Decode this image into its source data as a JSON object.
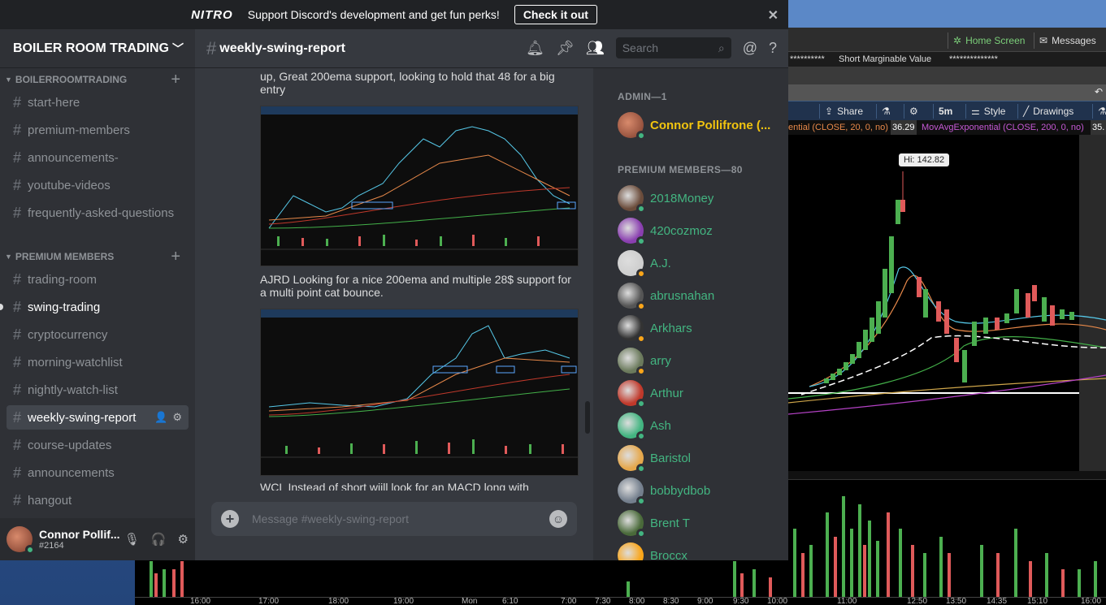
{
  "nitro": {
    "logo": "NITRO",
    "text": "Support Discord's development and get fun perks!",
    "button": "Check it out",
    "close": "✕"
  },
  "server": {
    "name": "BOILER ROOM TRADING"
  },
  "categories": [
    {
      "label": "BOILERROOMTRADING"
    },
    {
      "label": "PREMIUM MEMBERS"
    }
  ],
  "channels_top": [
    "start-here",
    "premium-members",
    "announcements-",
    "youtube-videos",
    "frequently-asked-questions"
  ],
  "channels_premium": [
    "trading-room",
    "swing-trading",
    "cryptocurrency",
    "morning-watchlist",
    "nightly-watch-list",
    "weekly-swing-report",
    "course-updates",
    "announcements",
    "hangout"
  ],
  "channel_header": {
    "title": "weekly-swing-report",
    "search_placeholder": "Search"
  },
  "messages": [
    {
      "text": "up, Great 200ema support, looking to hold that 48 for a big entry"
    },
    {
      "text": "AJRD Looking for a nice 200ema and multiple 28$ support for a multi point cat bounce."
    },
    {
      "text": "WCL Instead of short wiill look for an MACD long with"
    }
  ],
  "composer": {
    "placeholder": "Message #weekly-swing-report"
  },
  "user": {
    "name": "Connor Pollif...",
    "tag": "#2164"
  },
  "members": {
    "admin_header": "ADMIN—1",
    "admins": [
      {
        "name": "Connor Pollifrone (...",
        "status": "#43b581"
      }
    ],
    "premium_header": "PREMIUM MEMBERS—80",
    "premium": [
      {
        "name": "2018Money",
        "status": "#43b581",
        "color": "#6b4c3b"
      },
      {
        "name": "420cozmoz",
        "status": "#43b581",
        "color": "#8a3fb0"
      },
      {
        "name": "A.J.",
        "status": "#faa61a",
        "color": "#cfcfcf"
      },
      {
        "name": "abrusnahan",
        "status": "#faa61a",
        "color": "#555"
      },
      {
        "name": "Arkhars",
        "status": "#faa61a",
        "color": "#333"
      },
      {
        "name": "arry",
        "status": "#faa61a",
        "color": "#6b7a5c"
      },
      {
        "name": "Arthur",
        "status": "#43b581",
        "color": "#c0392b"
      },
      {
        "name": "Ash",
        "status": "#43b581",
        "color": "#43b581"
      },
      {
        "name": "Baristol",
        "status": "#43b581",
        "color": "#e6a84c"
      },
      {
        "name": "bobbydbob",
        "status": "#43b581",
        "color": "#747f8d"
      },
      {
        "name": "Brent T",
        "status": "#43b581",
        "color": "#4a6a3a"
      },
      {
        "name": "Broccx",
        "status": "#43b581",
        "color": "#faa61a"
      }
    ]
  },
  "trading": {
    "home_screen": "Home Screen",
    "messages": "Messages",
    "account_mask": "**********",
    "marginable_label": "Short Marginable Value",
    "marginable_mask": "**************",
    "toolbar": {
      "share": "Share",
      "interval": "5m",
      "style": "Style",
      "drawings": "Drawings"
    },
    "ind1": "ential (CLOSE, 20, 0, no)",
    "ind1_val": "36.29",
    "ind2": "MovAvgExponential (CLOSE, 200, 0, no)",
    "ind2_val": "35.",
    "hi_label": "Hi: 142.82",
    "times": [
      "16:00",
      "17:00",
      "18:00",
      "19:00",
      "Mon",
      "6:10",
      "7:00",
      "7:30",
      "8:00",
      "8:30",
      "9:00",
      "9:30",
      "10:00",
      "11:00",
      "12:50",
      "13:50",
      "14:35",
      "15:10",
      "16:00"
    ]
  }
}
